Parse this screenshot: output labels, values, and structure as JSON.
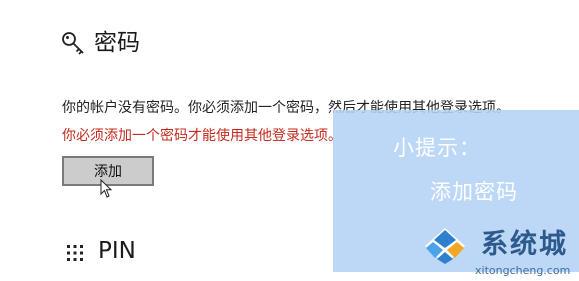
{
  "password_section": {
    "title": "密码",
    "icon": "key-icon",
    "description": "你的帐户没有密码。你必须添加一个密码，然后才能使用其他登录选项。",
    "error": "你必须添加一个密码才能使用其他登录选项。",
    "add_button": "添加"
  },
  "pin_section": {
    "title": "PIN",
    "icon": "keypad-icon"
  },
  "tip_overlay": {
    "label": "小提示：",
    "body": "添加密码"
  },
  "watermark": {
    "name": "系统城",
    "url": "xitongcheng.com"
  },
  "colors": {
    "error_red": "#c42b1c",
    "overlay_blue": "#b4d2f5",
    "watermark_blue": "#2d5a8c"
  }
}
